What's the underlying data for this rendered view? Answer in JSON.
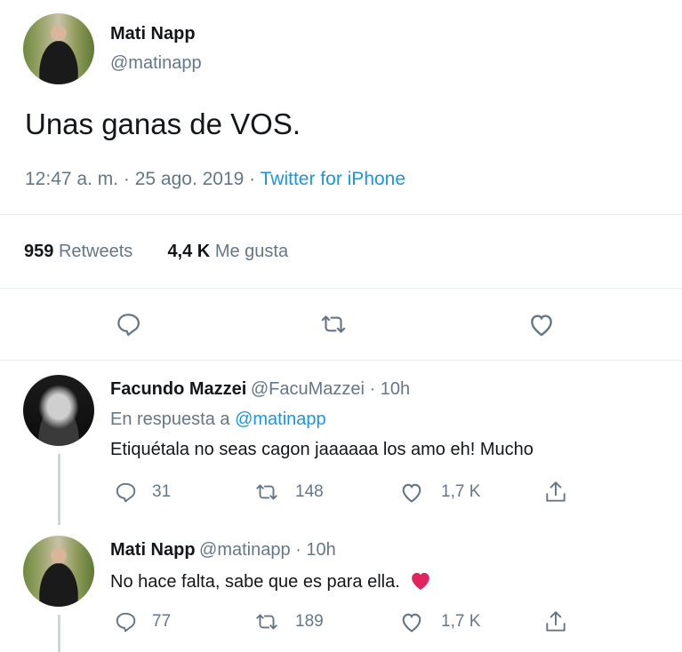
{
  "main_tweet": {
    "author_name": "Mati Napp",
    "author_handle": "@matinapp",
    "text": "Unas ganas de VOS.",
    "time": "12:47 a. m. · 25 ago. 2019 · ",
    "source": "Twitter for iPhone",
    "retweets_count": "959",
    "retweets_label": "Retweets",
    "likes_count": "4,4 K",
    "likes_label": "Me gusta"
  },
  "replies": [
    {
      "author_name": "Facundo Mazzei",
      "author_handle": "@FacuMazzei · 10h",
      "in_reply_prefix": "En respuesta a ",
      "in_reply_handle": "@matinapp",
      "text": "Etiquétala no seas cagon jaaaaaa los amo eh! Mucho",
      "reply_count": "31",
      "retweet_count": "148",
      "like_count": "1,7 K"
    },
    {
      "author_name": "Mati Napp",
      "author_handle": "@matinapp · 10h",
      "text": "No hace falta, sabe que es para ella.",
      "reply_count": "77",
      "retweet_count": "189",
      "like_count": "1,7 K"
    }
  ],
  "colors": {
    "link": "#1b95e0",
    "muted": "#657786",
    "heart_emoji": "#e0245e"
  }
}
